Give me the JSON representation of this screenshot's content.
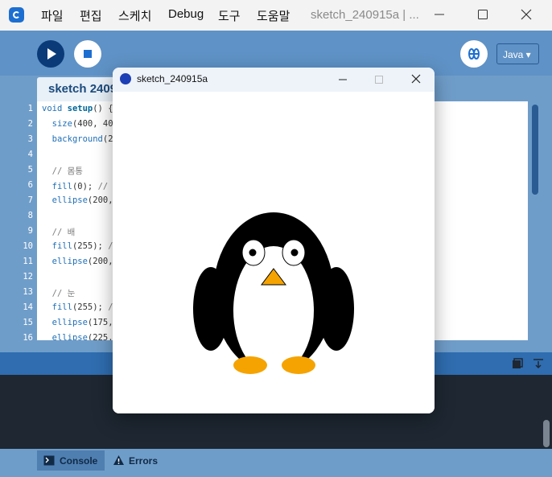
{
  "menu": {
    "items": [
      "파일",
      "편집",
      "스케치",
      "Debug",
      "도구",
      "도움말"
    ],
    "sketch_title": "sketch_240915a | ..."
  },
  "toolbar": {
    "run": "play-icon",
    "stop": "stop-icon",
    "debugger": "debugger-icon",
    "mode": "Java ▾"
  },
  "editor": {
    "tab_label": "sketch 2409",
    "line_numbers": [
      "1",
      "2",
      "3",
      "4",
      "5",
      "6",
      "7",
      "8",
      "9",
      "10",
      "11",
      "12",
      "13",
      "14",
      "15",
      "16"
    ]
  },
  "sketch_window": {
    "title": "sketch_240915a"
  },
  "console": {
    "tabs": [
      {
        "label": "Console",
        "icon": "terminal-icon"
      },
      {
        "label": "Errors",
        "icon": "warning-icon"
      }
    ]
  },
  "colors": {
    "accent": "#0b3a78",
    "background": "#6f9dc9",
    "penguin_beak": "#f5a300",
    "penguin_feet": "#f5a300"
  }
}
